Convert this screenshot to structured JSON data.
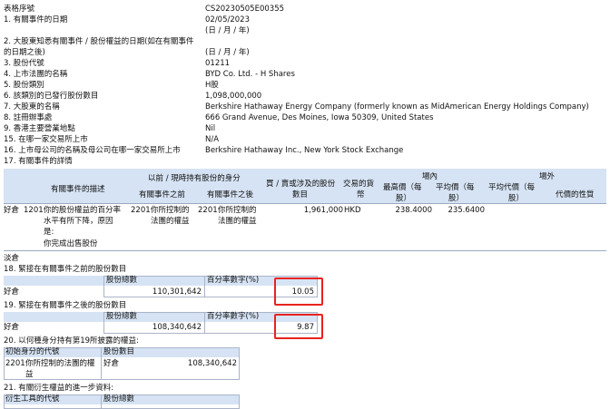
{
  "header": {
    "label": "表格序號",
    "value": "CS20230505E00355"
  },
  "rows": {
    "r1": {
      "label": "1. 有關事件的日期",
      "value": "02/05/2023",
      "hint": "(日 / 月 / 年)"
    },
    "r2": {
      "label_line1": "2. 大股東知悉有關事件 / 股份權益的日期(如在有關事件",
      "label_line2": "的日期之後)",
      "hint": "(日 / 月 / 年)"
    },
    "r3": {
      "label": "3. 股份代號",
      "value": "01211"
    },
    "r4": {
      "label": "4. 上市法團的名稱",
      "value": "BYD Co. Ltd. - H Shares"
    },
    "r5": {
      "label": "5. 股份類別",
      "value": "H股"
    },
    "r6": {
      "label": "6. 該類別的已發行股份數目",
      "value": "1,098,000,000"
    },
    "r7": {
      "label": "7. 大股東的名稱",
      "value": "Berkshire Hathaway Energy Company (formerly known as MidAmerican Energy Holdings Company)"
    },
    "r8": {
      "label": "8. 註冊辦事處",
      "value": "666 Grand Avenue, Des Moines, Iowa 50309, United States"
    },
    "r9": {
      "label": "9. 香港主要營業地點",
      "value": "Nil"
    },
    "r15": {
      "label": "15. 在哪一家交易所上市",
      "value": "N/A"
    },
    "r16": {
      "label": "16. 上市母公司的名稱及母公司在哪一家交易所上市",
      "value": "Berkshire Hathaway Inc., New York Stock Exchange"
    },
    "r17": {
      "label": "17. 有關事件的詳情"
    }
  },
  "events_table": {
    "h_desc": "有關事件的描述",
    "h_capacity_group": "以前 / 現時持有股份的身分",
    "h_before": "有關事件之前",
    "h_after": "有關事件之後",
    "h_shares_l1": "買 / 賣或涉及的股份",
    "h_shares_l2": "數目",
    "h_currency_l1": "交易的貨",
    "h_currency_l2": "幣",
    "h_onex": "場內",
    "h_offex": "場外",
    "h_high_l1": "最高價（每",
    "h_high_l2": "股）",
    "h_avg_l1": "平均價（每",
    "h_avg_l2": "股）",
    "h_avgoff_l1": "平均代價（每",
    "h_avgoff_l2": "股）",
    "h_consid": "代價的性質",
    "row": {
      "type": "好倉",
      "code": "1201",
      "desc_l1": "你的股份權益的百分率",
      "desc_l2": "水平有所下降，原因",
      "desc_l3": "是:",
      "desc_l4": "你完成出售股份",
      "before_code": "2201",
      "before_l1": "你所控制的",
      "before_l2": "法團的權益",
      "after_code": "2201",
      "after_l1": "你所控制的",
      "after_l2": "法團的權益",
      "shares": "1,961,000",
      "currency": "HKD",
      "high": "238.4000",
      "avg": "235.6400"
    }
  },
  "short_label": "淡倉",
  "r18": {
    "label": "18. 緊接在有關事件之前的股份數目",
    "col_total": "股份總數",
    "col_pct": "百分率數字(%)",
    "type": "好倉",
    "total": "110,301,642",
    "pct": "10.05"
  },
  "r19": {
    "label": "19. 緊接在有關事件之後的股份數目",
    "col_total": "股份總數",
    "col_pct": "百分率數字(%)",
    "type": "好倉",
    "total": "108,340,642",
    "pct": "9.87"
  },
  "r20": {
    "label": "20. 以何種身分持有第19所披露的權益:",
    "col_capacity": "初始身分的代號",
    "col_count": "股份數目",
    "code": "2201",
    "capacity_l1": "你所控制的法團的權",
    "capacity_l2": "益",
    "type": "好倉",
    "count": "108,340,642"
  },
  "r21": {
    "label": "21. 有關衍生權益的進一步資料:",
    "col_code": "衍生工具的代號",
    "col_total": "股份總數"
  },
  "colors": {
    "header_band": "#d6e3f4",
    "highlight": "#e8231f"
  }
}
